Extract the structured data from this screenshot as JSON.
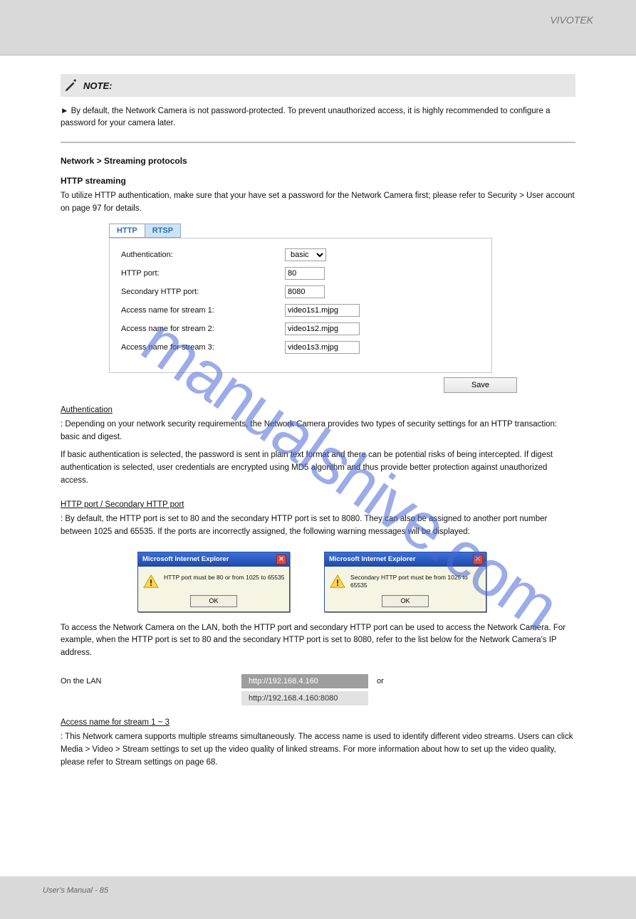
{
  "topbar": {
    "caption": "VIVOTEK"
  },
  "note": {
    "label": "NOTE:",
    "body": "► By default, the Network Camera is not password-protected. To prevent unauthorized access, it is highly recommended to configure a password for your camera later."
  },
  "stream_section": {
    "title": "Network > Streaming protocols",
    "http_heading": "HTTP streaming",
    "http_intro": "To utilize HTTP authentication, make sure that your have set a password for the Network Camera first; please refer to Security > User account on page 97 for details.",
    "tabs": {
      "active": "HTTP",
      "inactive": "RTSP"
    },
    "form": {
      "auth_label": "Authentication:",
      "auth_value": "basic",
      "http_port_label": "HTTP port:",
      "http_port_value": "80",
      "sec_port_label": "Secondary HTTP port:",
      "sec_port_value": "8080",
      "s1_label": "Access name for stream 1:",
      "s1_value": "video1s1.mjpg",
      "s2_label": "Access name for stream 2:",
      "s2_value": "video1s2.mjpg",
      "s3_label": "Access name for stream 3:",
      "s3_value": "video1s3.mjpg",
      "save_label": "Save"
    }
  },
  "auth_para": {
    "heading": "Authentication",
    "body": ": Depending on your network security requirements, the Network Camera provides two types of security settings for an HTTP transaction: basic and digest.",
    "para2": "If basic authentication is selected, the password is sent in plain text format and there can be potential risks of being intercepted. If digest authentication is selected, user credentials are encrypted using MD5 algorithm and thus provide better protection against unauthorized access."
  },
  "ports_para": {
    "heading": "HTTP port / Secondary HTTP port",
    "body": ": By default, the HTTP port is set to 80 and the secondary HTTP port is set to 8080. They can also be assigned to another port number between 1025 and 65535. If the ports are incorrectly assigned, the following warning messages will be displayed:"
  },
  "dialogs": {
    "title": "Microsoft Internet Explorer",
    "msg1": "HTTP port must be 80 or from 1025 to 65535",
    "msg2": "Secondary HTTP port must be from 1025 to 65535",
    "ok": "OK"
  },
  "access_para": "To access the Network Camera on the LAN, both the HTTP port and secondary HTTP port can be used to access the Network Camera. For example, when the HTTP port is set to 80 and the secondary HTTP port is set to 8080, refer to the list below for the Network Camera's IP address.",
  "url_rows": {
    "a_pre": "On the LAN",
    "a_chip": "http://192.168.4.160",
    "a_trail": "or",
    "b_chip": "http://192.168.4.160:8080"
  },
  "access_name": {
    "heading": "Access name for stream 1 ~ 3",
    "body": ": This Network camera supports multiple streams simultaneously. The access name is used to identify different video streams. Users can click Media > Video > Stream settings to set up the video quality of linked streams. For more information about how to set up the video quality, please refer to Stream settings on page 68."
  },
  "footer": {
    "left": "User's Manual - 85",
    "right": ""
  },
  "watermark": "manualshive.com"
}
